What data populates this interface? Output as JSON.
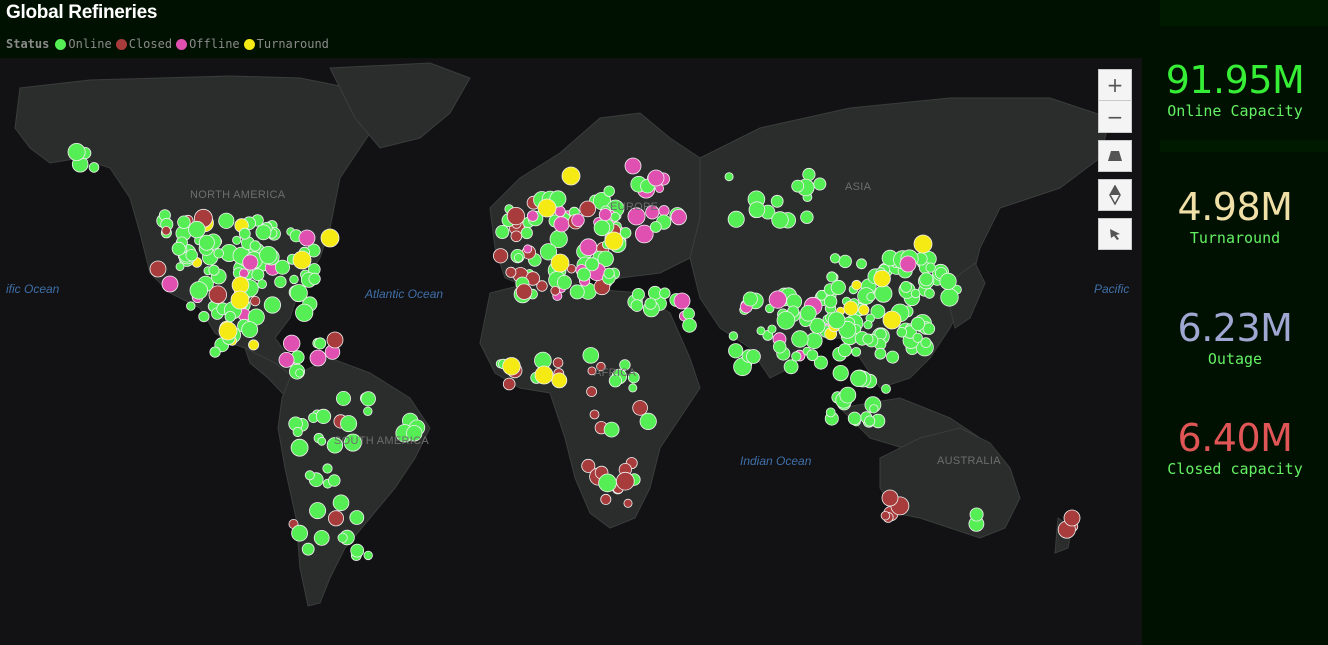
{
  "header": {
    "title": "Global Refineries"
  },
  "legend": {
    "label": "Status",
    "items": [
      {
        "label": "Online",
        "color": "#55ee55"
      },
      {
        "label": "Closed",
        "color": "#a83b3b"
      },
      {
        "label": "Offline",
        "color": "#e050b0"
      },
      {
        "label": "Turnaround",
        "color": "#f5ea14"
      }
    ]
  },
  "map": {
    "ocean_labels": [
      "ific Ocean",
      "Atlantic Ocean",
      "Indian Ocean",
      "Pacific"
    ],
    "region_labels": [
      "NORTH AMERICA",
      "SOUTH AMERICA",
      "EUROPE",
      "AFRICA",
      "ASIA",
      "AUSTRALIA"
    ],
    "controls": {
      "zoom_in": "+",
      "zoom_out": "−",
      "pitch_icon": "pitch-icon",
      "compass_icon": "compass-icon",
      "select_icon": "pointer-icon"
    }
  },
  "kpis": [
    {
      "value": "91.95M",
      "label": "Online Capacity",
      "value_color": "#36ee36",
      "label_color": "#64f064"
    },
    {
      "value": "4.98M",
      "label": "Turnaround",
      "value_color": "#f0e0a8",
      "label_color": "#64f064"
    },
    {
      "value": "6.23M",
      "label": "Outage",
      "value_color": "#9fa8d2",
      "label_color": "#64f064"
    },
    {
      "value": "6.40M",
      "label": "Closed capacity",
      "value_color": "#e05555",
      "label_color": "#64f064"
    }
  ]
}
